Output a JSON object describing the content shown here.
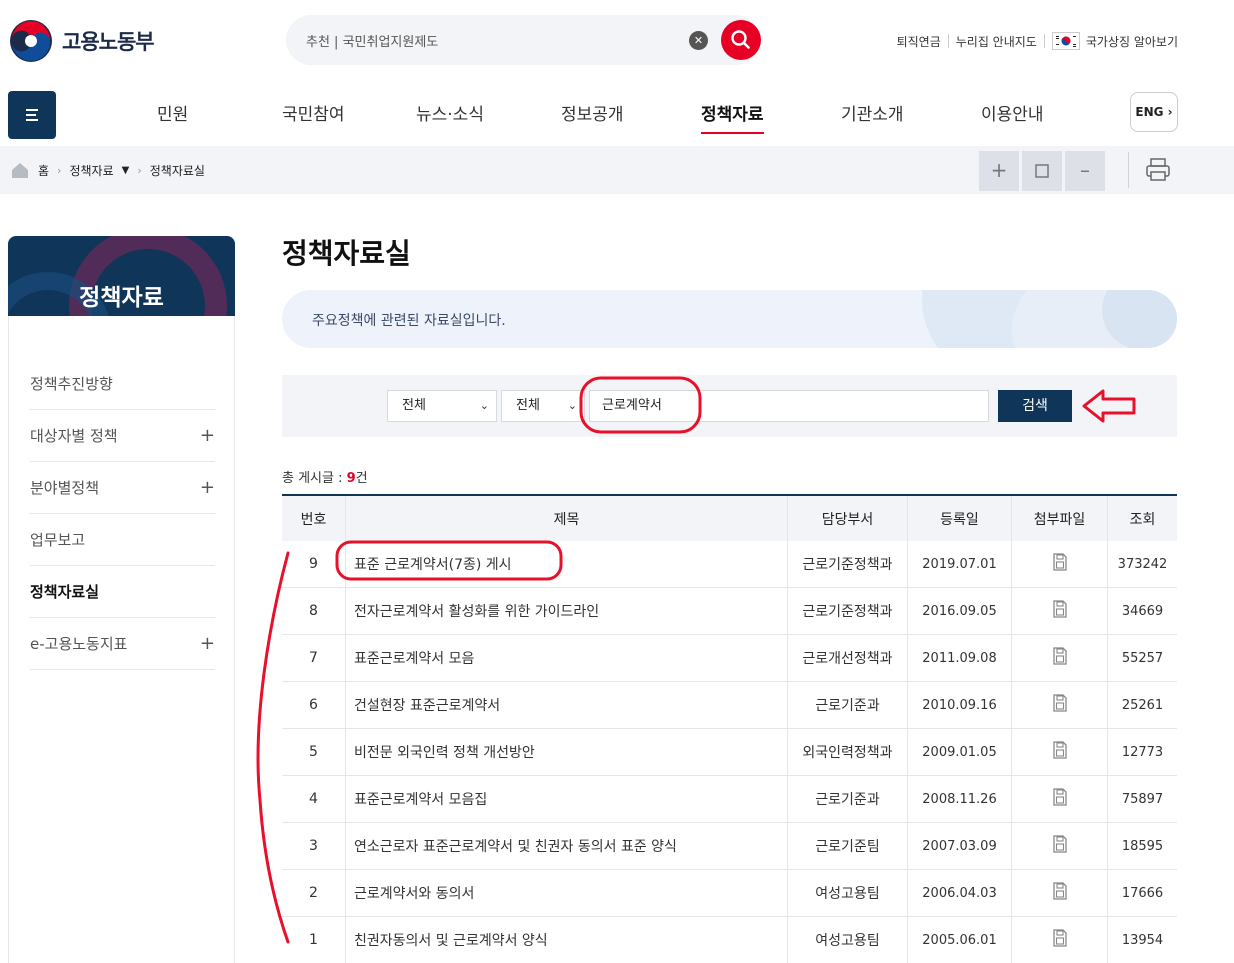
{
  "header": {
    "logo_text": "고용노동부",
    "search_value": "추천 | 국민취업지원제도",
    "top_links": [
      "퇴직연금",
      "누리집 안내지도",
      "국가상징 알아보기"
    ]
  },
  "gnb": {
    "items": [
      "민원",
      "국민참여",
      "뉴스·소식",
      "정보공개",
      "정책자료",
      "기관소개",
      "이용안내"
    ],
    "active": "정책자료",
    "lang_label": "ENG"
  },
  "breadcrumb": {
    "home": "홈",
    "level1": "정책자료",
    "level2": "정책자료실"
  },
  "sidebar": {
    "title": "정책자료",
    "items": [
      {
        "label": "정책추진방향",
        "expandable": false
      },
      {
        "label": "대상자별 정책",
        "expandable": true
      },
      {
        "label": "분야별정책",
        "expandable": true
      },
      {
        "label": "업무보고",
        "expandable": false
      },
      {
        "label": "정책자료실",
        "expandable": false,
        "active": true
      },
      {
        "label": "e-고용노동지표",
        "expandable": true
      }
    ],
    "plus": "+"
  },
  "main": {
    "title": "정책자료실",
    "intro": "주요정책에 관련된 자료실입니다.",
    "filter": {
      "select1": "전체",
      "select2": "전체",
      "keyword": "근로계약서",
      "search_label": "검색"
    },
    "total_label": "총 게시글 : ",
    "total_count": "9",
    "total_unit": "건"
  },
  "table": {
    "headers": [
      "번호",
      "제목",
      "담당부서",
      "등록일",
      "첨부파일",
      "조회"
    ],
    "rows": [
      {
        "no": "9",
        "title": "표준 근로계약서(7종) 게시",
        "dept": "근로기준정책과",
        "date": "2019.07.01",
        "views": "373242"
      },
      {
        "no": "8",
        "title": "전자근로계약서 활성화를 위한 가이드라인",
        "dept": "근로기준정책과",
        "date": "2016.09.05",
        "views": "34669"
      },
      {
        "no": "7",
        "title": "표준근로계약서 모음",
        "dept": "근로개선정책과",
        "date": "2011.09.08",
        "views": "55257"
      },
      {
        "no": "6",
        "title": "건설현장 표준근로계약서",
        "dept": "근로기준과",
        "date": "2010.09.16",
        "views": "25261"
      },
      {
        "no": "5",
        "title": "비전문 외국인력 정책 개선방안",
        "dept": "외국인력정책과",
        "date": "2009.01.05",
        "views": "12773"
      },
      {
        "no": "4",
        "title": "표준근로계약서 모음집",
        "dept": "근로기준과",
        "date": "2008.11.26",
        "views": "75897"
      },
      {
        "no": "3",
        "title": "연소근로자 표준근로계약서 및 친권자 동의서 표준 양식",
        "dept": "근로기준팀",
        "date": "2007.03.09",
        "views": "18595"
      },
      {
        "no": "2",
        "title": "근로계약서와 동의서",
        "dept": "여성고용팀",
        "date": "2006.04.03",
        "views": "17666"
      },
      {
        "no": "1",
        "title": "친권자동의서 및 근로계약서 양식",
        "dept": "여성고용팀",
        "date": "2005.06.01",
        "views": "13954"
      }
    ]
  },
  "colors": {
    "brand_navy": "#0f3559",
    "accent_red": "#e60026",
    "annotation_red": "#e8102a"
  }
}
